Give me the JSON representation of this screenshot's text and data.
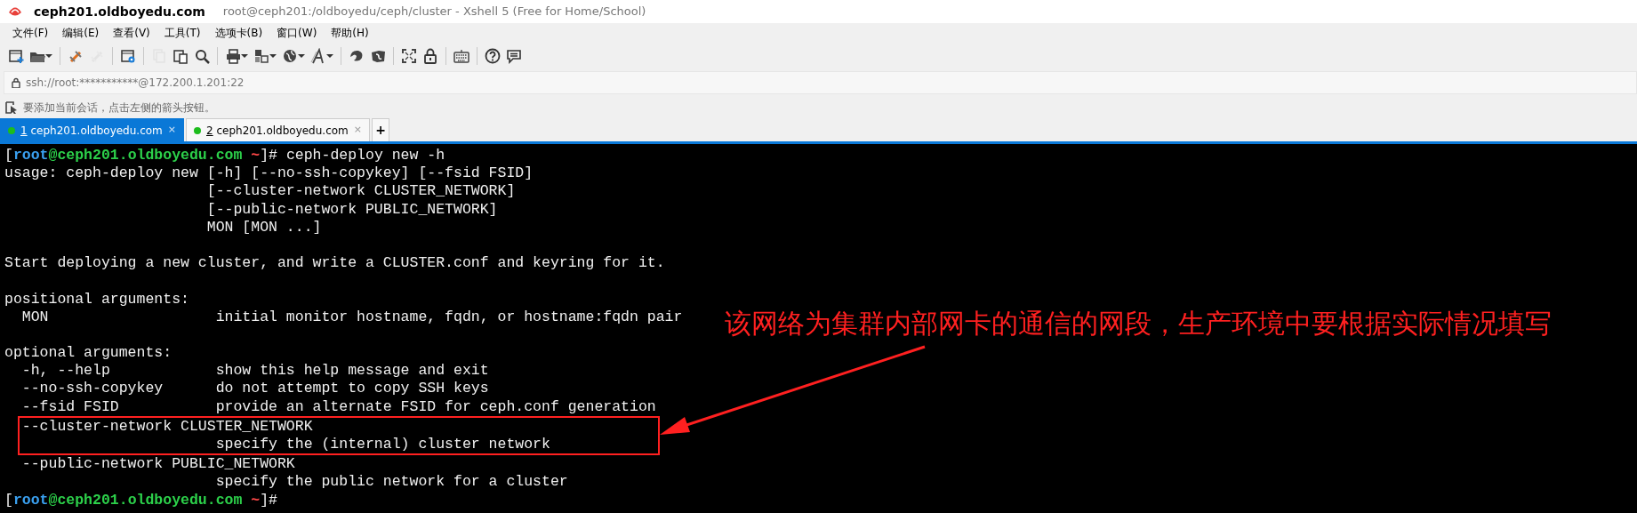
{
  "window": {
    "host": "ceph201.oldboyedu.com",
    "title": "root@ceph201:/oldboyedu/ceph/cluster - Xshell 5 (Free for Home/School)"
  },
  "menu": [
    "文件(F)",
    "编辑(E)",
    "查看(V)",
    "工具(T)",
    "选项卡(B)",
    "窗口(W)",
    "帮助(H)"
  ],
  "toolbar": [
    {
      "kind": "new",
      "disabled": false,
      "dropdown": false
    },
    {
      "kind": "folder",
      "disabled": false,
      "dropdown": true
    },
    {
      "kind": "sep"
    },
    {
      "kind": "connect",
      "disabled": false,
      "dropdown": false
    },
    {
      "kind": "disconnect",
      "disabled": true,
      "dropdown": false
    },
    {
      "kind": "sep"
    },
    {
      "kind": "properties",
      "disabled": false,
      "dropdown": false
    },
    {
      "kind": "sep"
    },
    {
      "kind": "copy",
      "disabled": true,
      "dropdown": false
    },
    {
      "kind": "paste",
      "disabled": false,
      "dropdown": false
    },
    {
      "kind": "find",
      "disabled": false,
      "dropdown": false
    },
    {
      "kind": "sep"
    },
    {
      "kind": "print",
      "disabled": false,
      "dropdown": true
    },
    {
      "kind": "transfer",
      "disabled": false,
      "dropdown": true
    },
    {
      "kind": "globe",
      "disabled": false,
      "dropdown": true
    },
    {
      "kind": "font",
      "disabled": false,
      "dropdown": true
    },
    {
      "kind": "sep"
    },
    {
      "kind": "shell",
      "disabled": false,
      "dropdown": false
    },
    {
      "kind": "ftp",
      "disabled": false,
      "dropdown": false
    },
    {
      "kind": "sep"
    },
    {
      "kind": "fullscreen",
      "disabled": false,
      "dropdown": false
    },
    {
      "kind": "lock",
      "disabled": false,
      "dropdown": false
    },
    {
      "kind": "sep"
    },
    {
      "kind": "keyboard",
      "disabled": false,
      "dropdown": false
    },
    {
      "kind": "sep"
    },
    {
      "kind": "help",
      "disabled": false,
      "dropdown": false
    },
    {
      "kind": "chat",
      "disabled": false,
      "dropdown": false
    }
  ],
  "address": "ssh://root:***********@172.200.1.201:22",
  "hint": "要添加当前会话，点击左侧的箭头按钮。",
  "tabs": [
    {
      "number": "1",
      "label": "ceph201.oldboyedu.com",
      "close": "×",
      "selected": true
    },
    {
      "number": "2",
      "label": "ceph201.oldboyedu.com",
      "close": "×",
      "selected": false
    }
  ],
  "new_tab": "+",
  "terminal": [
    {
      "kind": "prompt",
      "user": "root",
      "host": "@ceph201.oldboyedu.com",
      "dir": "~",
      "open": "[",
      "close": "]#",
      "command": " ceph-deploy new -h"
    },
    {
      "kind": "text",
      "text": "usage: ceph-deploy new [-h] [--no-ssh-copykey] [--fsid FSID]"
    },
    {
      "kind": "text",
      "text": "                       [--cluster-network CLUSTER_NETWORK]"
    },
    {
      "kind": "text",
      "text": "                       [--public-network PUBLIC_NETWORK]"
    },
    {
      "kind": "text",
      "text": "                       MON [MON ...]"
    },
    {
      "kind": "blank"
    },
    {
      "kind": "text",
      "text": "Start deploying a new cluster, and write a CLUSTER.conf and keyring for it."
    },
    {
      "kind": "blank"
    },
    {
      "kind": "text",
      "text": "positional arguments:"
    },
    {
      "kind": "text",
      "text": "  MON                   initial monitor hostname, fqdn, or hostname:fqdn pair"
    },
    {
      "kind": "blank"
    },
    {
      "kind": "text",
      "text": "optional arguments:"
    },
    {
      "kind": "text",
      "text": "  -h, --help            show this help message and exit"
    },
    {
      "kind": "text",
      "text": "  --no-ssh-copykey      do not attempt to copy SSH keys"
    },
    {
      "kind": "text",
      "text": "  --fsid FSID           provide an alternate FSID for ceph.conf generation"
    },
    {
      "kind": "text",
      "text": "  --cluster-network CLUSTER_NETWORK",
      "highlighted": true
    },
    {
      "kind": "text",
      "text": "                        specify the (internal) cluster network",
      "highlighted": true
    },
    {
      "kind": "text",
      "text": "  --public-network PUBLIC_NETWORK"
    },
    {
      "kind": "text",
      "text": "                        specify the public network for a cluster"
    },
    {
      "kind": "prompt",
      "user": "root",
      "host": "@ceph201.oldboyedu.com",
      "dir": "~",
      "open": "[",
      "close": "]#"
    }
  ],
  "annotation": {
    "text": "该网络为集群内部网卡的通信的网段，生产环境中要根据实际情况填写"
  }
}
